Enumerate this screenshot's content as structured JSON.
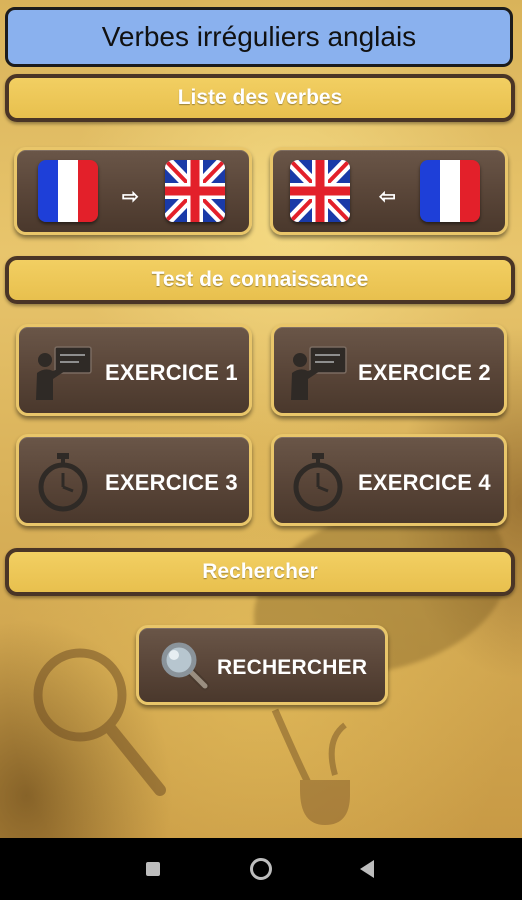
{
  "app": {
    "title": "Verbes irréguliers anglais"
  },
  "sections": {
    "list": {
      "title": "Liste des verbes"
    },
    "test": {
      "title": "Test de connaissance"
    },
    "search": {
      "title": "Rechercher"
    }
  },
  "list_buttons": {
    "fr_to_en": {
      "arrow": "⇨",
      "from_flag": "france-flag-icon",
      "to_flag": "uk-flag-icon"
    },
    "en_to_fr": {
      "arrow": "⇦",
      "from_flag": "uk-flag-icon",
      "to_flag": "france-flag-icon"
    }
  },
  "exercises": {
    "ex1": {
      "label": "EXERCICE 1",
      "icon": "teacher-board-icon"
    },
    "ex2": {
      "label": "EXERCICE 2",
      "icon": "teacher-board-icon"
    },
    "ex3": {
      "label": "EXERCICE 3",
      "icon": "stopwatch-icon"
    },
    "ex4": {
      "label": "EXERCICE 4",
      "icon": "stopwatch-icon"
    }
  },
  "search_button": {
    "label": "RECHERCHER",
    "icon": "magnifier-icon"
  },
  "navbar": {
    "items": [
      "square-icon",
      "circle-icon",
      "triangle-back-icon"
    ]
  },
  "colors": {
    "title_bg": "#8ab1ee",
    "section_bg": "#efc95a",
    "button_bg": "#5a4639",
    "button_border": "#e9c66a"
  }
}
